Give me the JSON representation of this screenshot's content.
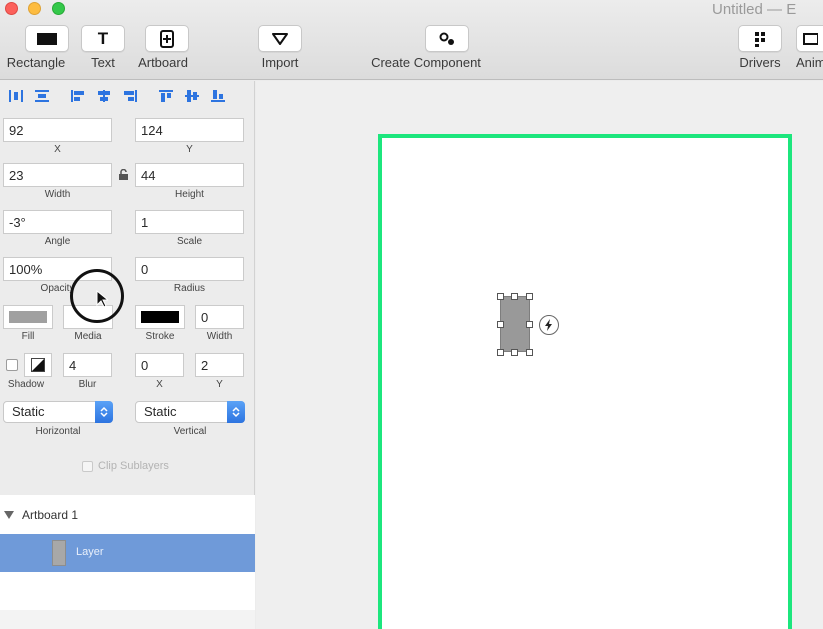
{
  "window": {
    "title": "Untitled — E"
  },
  "toolbar": {
    "tools": [
      {
        "label": "Rectangle",
        "icon": "rectangle-icon"
      },
      {
        "label": "Text",
        "icon": "text-icon"
      },
      {
        "label": "Artboard",
        "icon": "artboard-icon"
      },
      {
        "label": "Import",
        "icon": "import-icon"
      },
      {
        "label": "Create Component",
        "icon": "component-icon"
      },
      {
        "label": "Drivers",
        "icon": "drivers-icon"
      },
      {
        "label": "Anim",
        "icon": "animations-icon"
      }
    ],
    "text_glyph": "T"
  },
  "inspector": {
    "x": {
      "value": "92",
      "label": "X"
    },
    "y": {
      "value": "124",
      "label": "Y"
    },
    "width": {
      "value": "23",
      "label": "Width"
    },
    "height": {
      "value": "44",
      "label": "Height"
    },
    "angle": {
      "value": "-3°",
      "label": "Angle"
    },
    "scale": {
      "value": "1",
      "label": "Scale"
    },
    "opacity": {
      "value": "100%",
      "label": "Opacity"
    },
    "radius": {
      "value": "0",
      "label": "Radius"
    },
    "fill": {
      "label": "Fill",
      "color": "#a0a0a0"
    },
    "media": {
      "label": "Media"
    },
    "stroke": {
      "label": "Stroke",
      "color": "#000000"
    },
    "stroke_width": {
      "value": "0",
      "label": "Width"
    },
    "shadow": {
      "label": "Shadow"
    },
    "blur": {
      "value": "4",
      "label": "Blur"
    },
    "shadow_x": {
      "value": "0",
      "label": "X"
    },
    "shadow_y": {
      "value": "2",
      "label": "Y"
    },
    "horizontal": {
      "value": "Static",
      "label": "Horizontal"
    },
    "vertical": {
      "value": "Static",
      "label": "Vertical"
    },
    "clip_sublayers": {
      "label": "Clip Sublayers"
    }
  },
  "layers": {
    "artboard": {
      "label": "Artboard 1"
    },
    "selected": {
      "label": "Layer"
    }
  },
  "colors": {
    "accent": "#2d74e0",
    "artboard_border": "#1ce67d",
    "selection": "#6f9ad9"
  }
}
